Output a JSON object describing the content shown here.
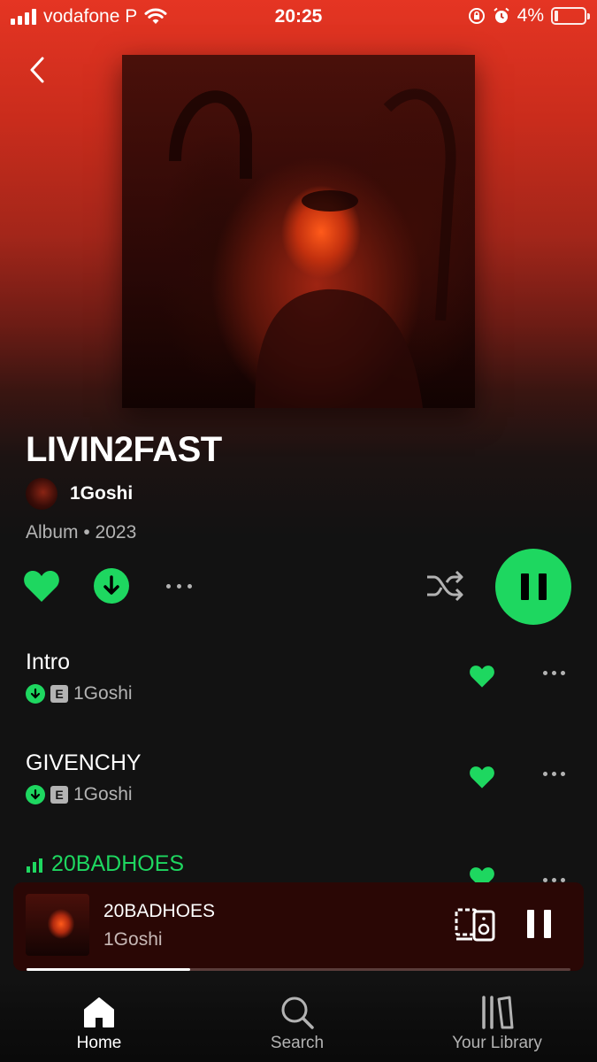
{
  "status_bar": {
    "carrier": "vodafone P",
    "time": "20:25",
    "battery": "4%"
  },
  "album": {
    "title": "LIVIN2FAST",
    "artist": "1Goshi",
    "meta": "Album • 2023"
  },
  "tracks": [
    {
      "name": "Intro",
      "artist": "1Goshi",
      "explicit_badge": "E"
    },
    {
      "name": "GIVENCHY",
      "artist": "1Goshi",
      "explicit_badge": "E"
    },
    {
      "name": "20BADHOES"
    }
  ],
  "now_playing": {
    "title": "20BADHOES",
    "artist": "1Goshi",
    "progress": 0.3
  },
  "tabs": [
    {
      "label": "Home"
    },
    {
      "label": "Search"
    },
    {
      "label": "Your Library"
    }
  ],
  "colors": {
    "accent": "#1ed760",
    "header": "#e53523",
    "background": "#121212"
  }
}
